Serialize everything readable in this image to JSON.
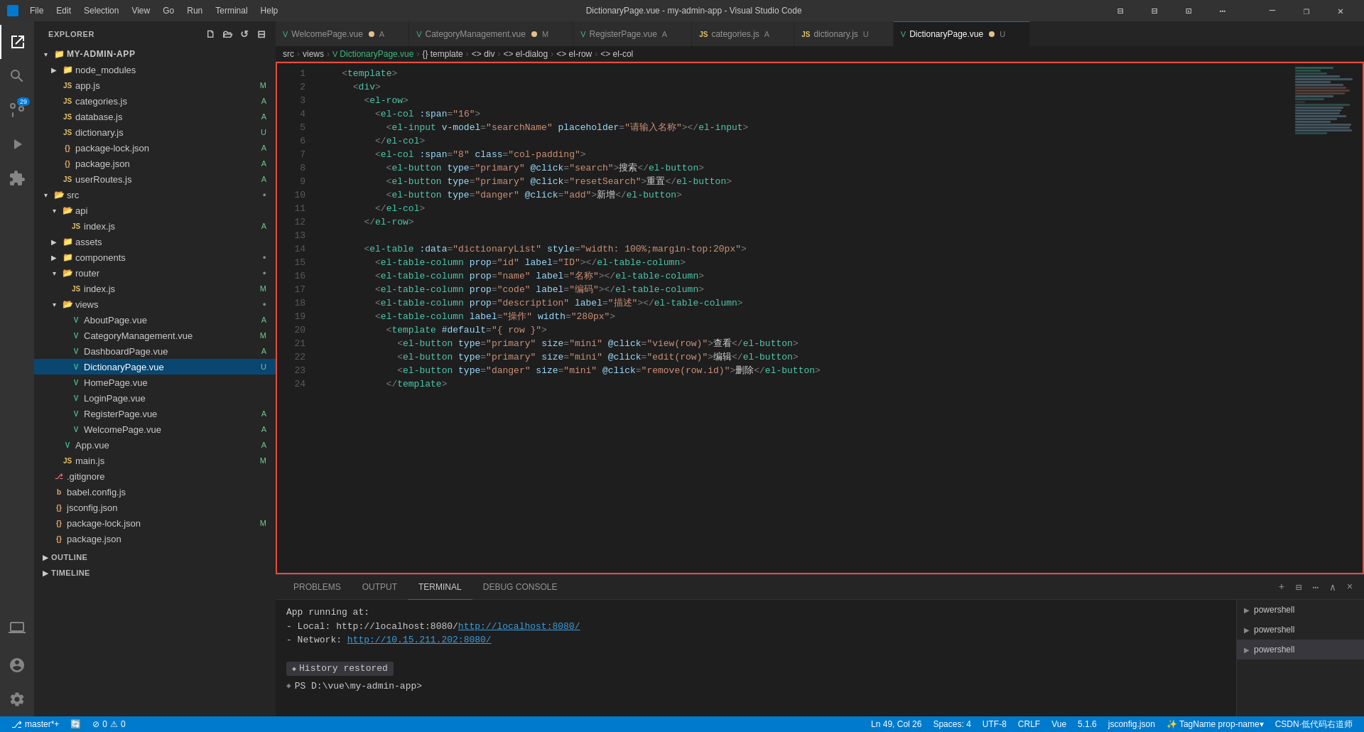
{
  "titleBar": {
    "icon": "VS",
    "menus": [
      "File",
      "Edit",
      "Selection",
      "View",
      "Go",
      "Run",
      "Terminal",
      "Help"
    ],
    "title": "DictionaryPage.vue - my-admin-app - Visual Studio Code",
    "buttons": [
      "⊟",
      "❐",
      "✕"
    ]
  },
  "activityBar": {
    "items": [
      {
        "name": "explorer",
        "icon": "📄",
        "active": true
      },
      {
        "name": "search",
        "icon": "🔍",
        "active": false
      },
      {
        "name": "source-control",
        "icon": "⎇",
        "active": false,
        "badge": "29"
      },
      {
        "name": "run-debug",
        "icon": "▶",
        "active": false
      },
      {
        "name": "extensions",
        "icon": "⊞",
        "active": false
      },
      {
        "name": "remote-explorer",
        "icon": "🖥",
        "active": false
      }
    ],
    "bottomItems": [
      {
        "name": "accounts",
        "icon": "👤"
      },
      {
        "name": "settings",
        "icon": "⚙"
      }
    ]
  },
  "sidebar": {
    "title": "EXPLORER",
    "project": "MY-ADMIN-APP",
    "tree": [
      {
        "id": "node_modules",
        "label": "node_modules",
        "indent": 2,
        "type": "folder",
        "collapsed": true
      },
      {
        "id": "app.js",
        "label": "app.js",
        "indent": 2,
        "type": "js",
        "badge": "M"
      },
      {
        "id": "categories.js",
        "label": "categories.js",
        "indent": 2,
        "type": "js",
        "badge": "A"
      },
      {
        "id": "database.js",
        "label": "database.js",
        "indent": 2,
        "type": "js",
        "badge": "A"
      },
      {
        "id": "dictionary.js",
        "label": "dictionary.js",
        "indent": 2,
        "type": "js",
        "badge": "U"
      },
      {
        "id": "package-lock.json",
        "label": "package-lock.json",
        "indent": 2,
        "type": "json",
        "badge": "A"
      },
      {
        "id": "package.json",
        "label": "package.json",
        "indent": 2,
        "type": "json",
        "badge": "A"
      },
      {
        "id": "userRoutes.js",
        "label": "userRoutes.js",
        "indent": 2,
        "type": "js",
        "badge": "A"
      },
      {
        "id": "src",
        "label": "src",
        "indent": 1,
        "type": "folder-open",
        "collapsed": false
      },
      {
        "id": "api",
        "label": "api",
        "indent": 2,
        "type": "folder-open"
      },
      {
        "id": "index.js-api",
        "label": "index.js",
        "indent": 3,
        "type": "js",
        "badge": "A"
      },
      {
        "id": "assets",
        "label": "assets",
        "indent": 2,
        "type": "folder",
        "collapsed": true
      },
      {
        "id": "components",
        "label": "components",
        "indent": 2,
        "type": "folder"
      },
      {
        "id": "router",
        "label": "router",
        "indent": 2,
        "type": "folder-open"
      },
      {
        "id": "index.js-router",
        "label": "index.js",
        "indent": 3,
        "type": "js",
        "badge": "M"
      },
      {
        "id": "views",
        "label": "views",
        "indent": 2,
        "type": "folder-open"
      },
      {
        "id": "AboutPage.vue",
        "label": "AboutPage.vue",
        "indent": 3,
        "type": "vue",
        "badge": "A"
      },
      {
        "id": "CategoryManagement.vue",
        "label": "CategoryManagement.vue",
        "indent": 3,
        "type": "vue",
        "badge": "M"
      },
      {
        "id": "DashboardPage.vue",
        "label": "DashboardPage.vue",
        "indent": 3,
        "type": "vue",
        "badge": "A"
      },
      {
        "id": "DictionaryPage.vue",
        "label": "DictionaryPage.vue",
        "indent": 3,
        "type": "vue",
        "badge": "U",
        "selected": true
      },
      {
        "id": "HomePage.vue",
        "label": "HomePage.vue",
        "indent": 3,
        "type": "vue"
      },
      {
        "id": "LoginPage.vue",
        "label": "LoginPage.vue",
        "indent": 3,
        "type": "vue"
      },
      {
        "id": "RegisterPage.vue",
        "label": "RegisterPage.vue",
        "indent": 3,
        "type": "vue",
        "badge": "A"
      },
      {
        "id": "WelcomePage.vue",
        "label": "WelcomePage.vue",
        "indent": 3,
        "type": "vue",
        "badge": "A"
      },
      {
        "id": "App.vue",
        "label": "App.vue",
        "indent": 2,
        "type": "vue",
        "badge": "A"
      },
      {
        "id": "main.js",
        "label": "main.js",
        "indent": 2,
        "type": "js",
        "badge": "M"
      },
      {
        "id": "gitignore",
        "label": ".gitignore",
        "indent": 1,
        "type": "git"
      },
      {
        "id": "babel.config.js",
        "label": "babel.config.js",
        "indent": 1,
        "type": "js"
      },
      {
        "id": "jsconfig.json",
        "label": "jsconfig.json",
        "indent": 1,
        "type": "json"
      },
      {
        "id": "package-lock-root.json",
        "label": "package-lock.json",
        "indent": 1,
        "type": "json",
        "badge": "M"
      },
      {
        "id": "package-root.json",
        "label": "package.json",
        "indent": 1,
        "type": "json"
      }
    ],
    "sections": [
      {
        "id": "outline",
        "label": "OUTLINE"
      },
      {
        "id": "timeline",
        "label": "TIMELINE"
      }
    ]
  },
  "tabs": [
    {
      "id": "welcome",
      "label": "WelcomePage.vue",
      "type": "vue",
      "modified": true,
      "badge": "A"
    },
    {
      "id": "category",
      "label": "CategoryManagement.vue",
      "type": "vue",
      "modified": true,
      "badge": "M"
    },
    {
      "id": "register",
      "label": "RegisterPage.vue",
      "type": "vue",
      "modified": false,
      "badge": "A"
    },
    {
      "id": "categories-js",
      "label": "categories.js",
      "type": "js",
      "modified": false,
      "badge": "A"
    },
    {
      "id": "dictionary-js",
      "label": "dictionary.js",
      "type": "js",
      "modified": false,
      "badge": "U"
    },
    {
      "id": "dictionary-vue",
      "label": "DictionaryPage.vue",
      "type": "vue",
      "active": true,
      "modified": true,
      "badge": "U"
    }
  ],
  "breadcrumb": {
    "items": [
      "src",
      "views",
      "DictionaryPage.vue",
      "{} template",
      "<> div",
      "<> el-dialog",
      "<> el-row",
      "<> el-col"
    ]
  },
  "editor": {
    "lines": [
      {
        "num": 1,
        "content": "    <template>"
      },
      {
        "num": 2,
        "content": "      <div>"
      },
      {
        "num": 3,
        "content": "        <el-row>"
      },
      {
        "num": 4,
        "content": "          <el-col :span=\"16\">"
      },
      {
        "num": 5,
        "content": "            <el-input v-model=\"searchName\" placeholder=\"请输入名称\"></el-input>"
      },
      {
        "num": 6,
        "content": "          </el-col>"
      },
      {
        "num": 7,
        "content": "          <el-col :span=\"8\" class=\"col-padding\">"
      },
      {
        "num": 8,
        "content": "            <el-button type=\"primary\" @click=\"search\">搜索</el-button>"
      },
      {
        "num": 9,
        "content": "            <el-button type=\"primary\" @click=\"resetSearch\">重置</el-button>"
      },
      {
        "num": 10,
        "content": "            <el-button type=\"danger\" @click=\"add\">新增</el-button>"
      },
      {
        "num": 11,
        "content": "          </el-col>"
      },
      {
        "num": 12,
        "content": "        </el-row>"
      },
      {
        "num": 13,
        "content": ""
      },
      {
        "num": 14,
        "content": "        <el-table :data=\"dictionaryList\" style=\"width: 100%;margin-top:20px\">"
      },
      {
        "num": 15,
        "content": "          <el-table-column prop=\"id\" label=\"ID\"></el-table-column>"
      },
      {
        "num": 16,
        "content": "          <el-table-column prop=\"name\" label=\"名称\"></el-table-column>"
      },
      {
        "num": 17,
        "content": "          <el-table-column prop=\"code\" label=\"编码\"></el-table-column>"
      },
      {
        "num": 18,
        "content": "          <el-table-column prop=\"description\" label=\"描述\"></el-table-column>"
      },
      {
        "num": 19,
        "content": "          <el-table-column label=\"操作\" width=\"280px\">"
      },
      {
        "num": 20,
        "content": "            <template #default=\"{ row }\">"
      },
      {
        "num": 21,
        "content": "              <el-button type=\"primary\" size=\"mini\" @click=\"view(row)\">查看</el-button>"
      },
      {
        "num": 22,
        "content": "              <el-button type=\"primary\" size=\"mini\" @click=\"edit(row)\">编辑</el-button>"
      },
      {
        "num": 23,
        "content": "              <el-button type=\"danger\" size=\"mini\" @click=\"remove(row.id)\">删除</el-button>"
      },
      {
        "num": 24,
        "content": "            </template>"
      }
    ]
  },
  "terminal": {
    "tabs": [
      "PROBLEMS",
      "OUTPUT",
      "TERMINAL",
      "DEBUG CONSOLE"
    ],
    "activeTab": "TERMINAL",
    "content": {
      "appRunning": "App running at:",
      "local": "  - Local:    http://localhost:8080/",
      "network": "  - Network:  http://10.15.211.202:8080/",
      "historyRestored": "History restored",
      "prompt": "PS D:\\vue\\my-admin-app>"
    },
    "panels": [
      "powershell",
      "powershell",
      "powershell"
    ]
  },
  "statusBar": {
    "left": [
      {
        "id": "branch",
        "text": "⎇ master*+"
      },
      {
        "id": "sync",
        "text": "🔄"
      },
      {
        "id": "errors",
        "text": "⊘ 0  ⚠ 0"
      }
    ],
    "right": [
      {
        "id": "position",
        "text": "Ln 49, Col 26"
      },
      {
        "id": "spaces",
        "text": "Spaces: 4"
      },
      {
        "id": "encoding",
        "text": "UTF-8"
      },
      {
        "id": "eol",
        "text": "CRLF"
      },
      {
        "id": "language",
        "text": "Vue"
      },
      {
        "id": "version",
        "text": "5.1.6"
      },
      {
        "id": "config",
        "text": "jsconfig.json"
      },
      {
        "id": "prettier",
        "text": "✨ TagName prop-name▾"
      },
      {
        "id": "csdn",
        "text": "CSDN·低代码右道师"
      }
    ]
  }
}
